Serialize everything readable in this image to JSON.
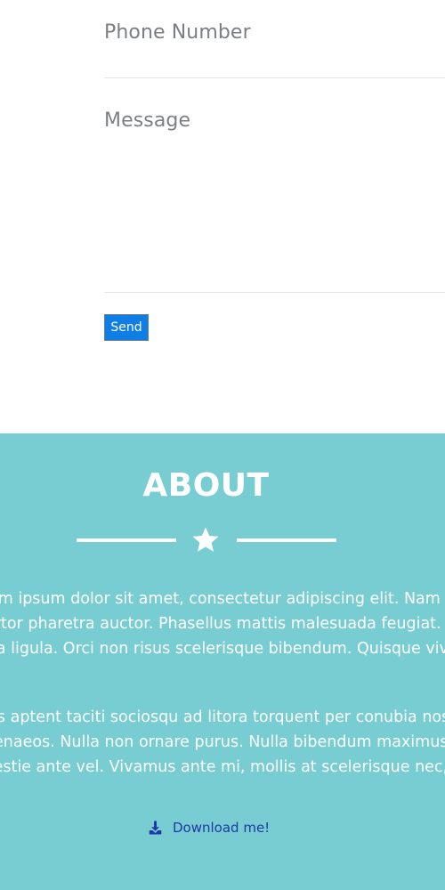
{
  "contact_form": {
    "phone_placeholder": "Phone Number",
    "message_placeholder": "Message",
    "send_label": "Send"
  },
  "about": {
    "title": "ABOUT",
    "divider_icon": "star-icon",
    "paragraph_1": [
      "Lorem ipsum dolor sit amet, consectetur adipiscing elit. Nam blandit turpis",
      "a tortor pharetra auctor. Phasellus mattis malesuada feugiat. Quisque in",
      "porta ligula. Orci non risus scelerisque bibendum. Quisque viverra vulputate"
    ],
    "paragraph_2": [
      "Class aptent taciti sociosqu ad litora torquent per conubia nostra, per inceptos",
      "himenaeos. Nulla non ornare purus. Nulla bibendum maximus urna, sed",
      "molestie ante vel. Vivamus ante mi, mollis at scelerisque nec, feugiat non"
    ],
    "download_label": "Download me!",
    "download_icon": "download-icon"
  },
  "colors": {
    "about_background": "#78cdd3",
    "send_button": "#0f7fe5",
    "link": "#1d3aa6",
    "placeholder_text": "#7b7f84"
  }
}
